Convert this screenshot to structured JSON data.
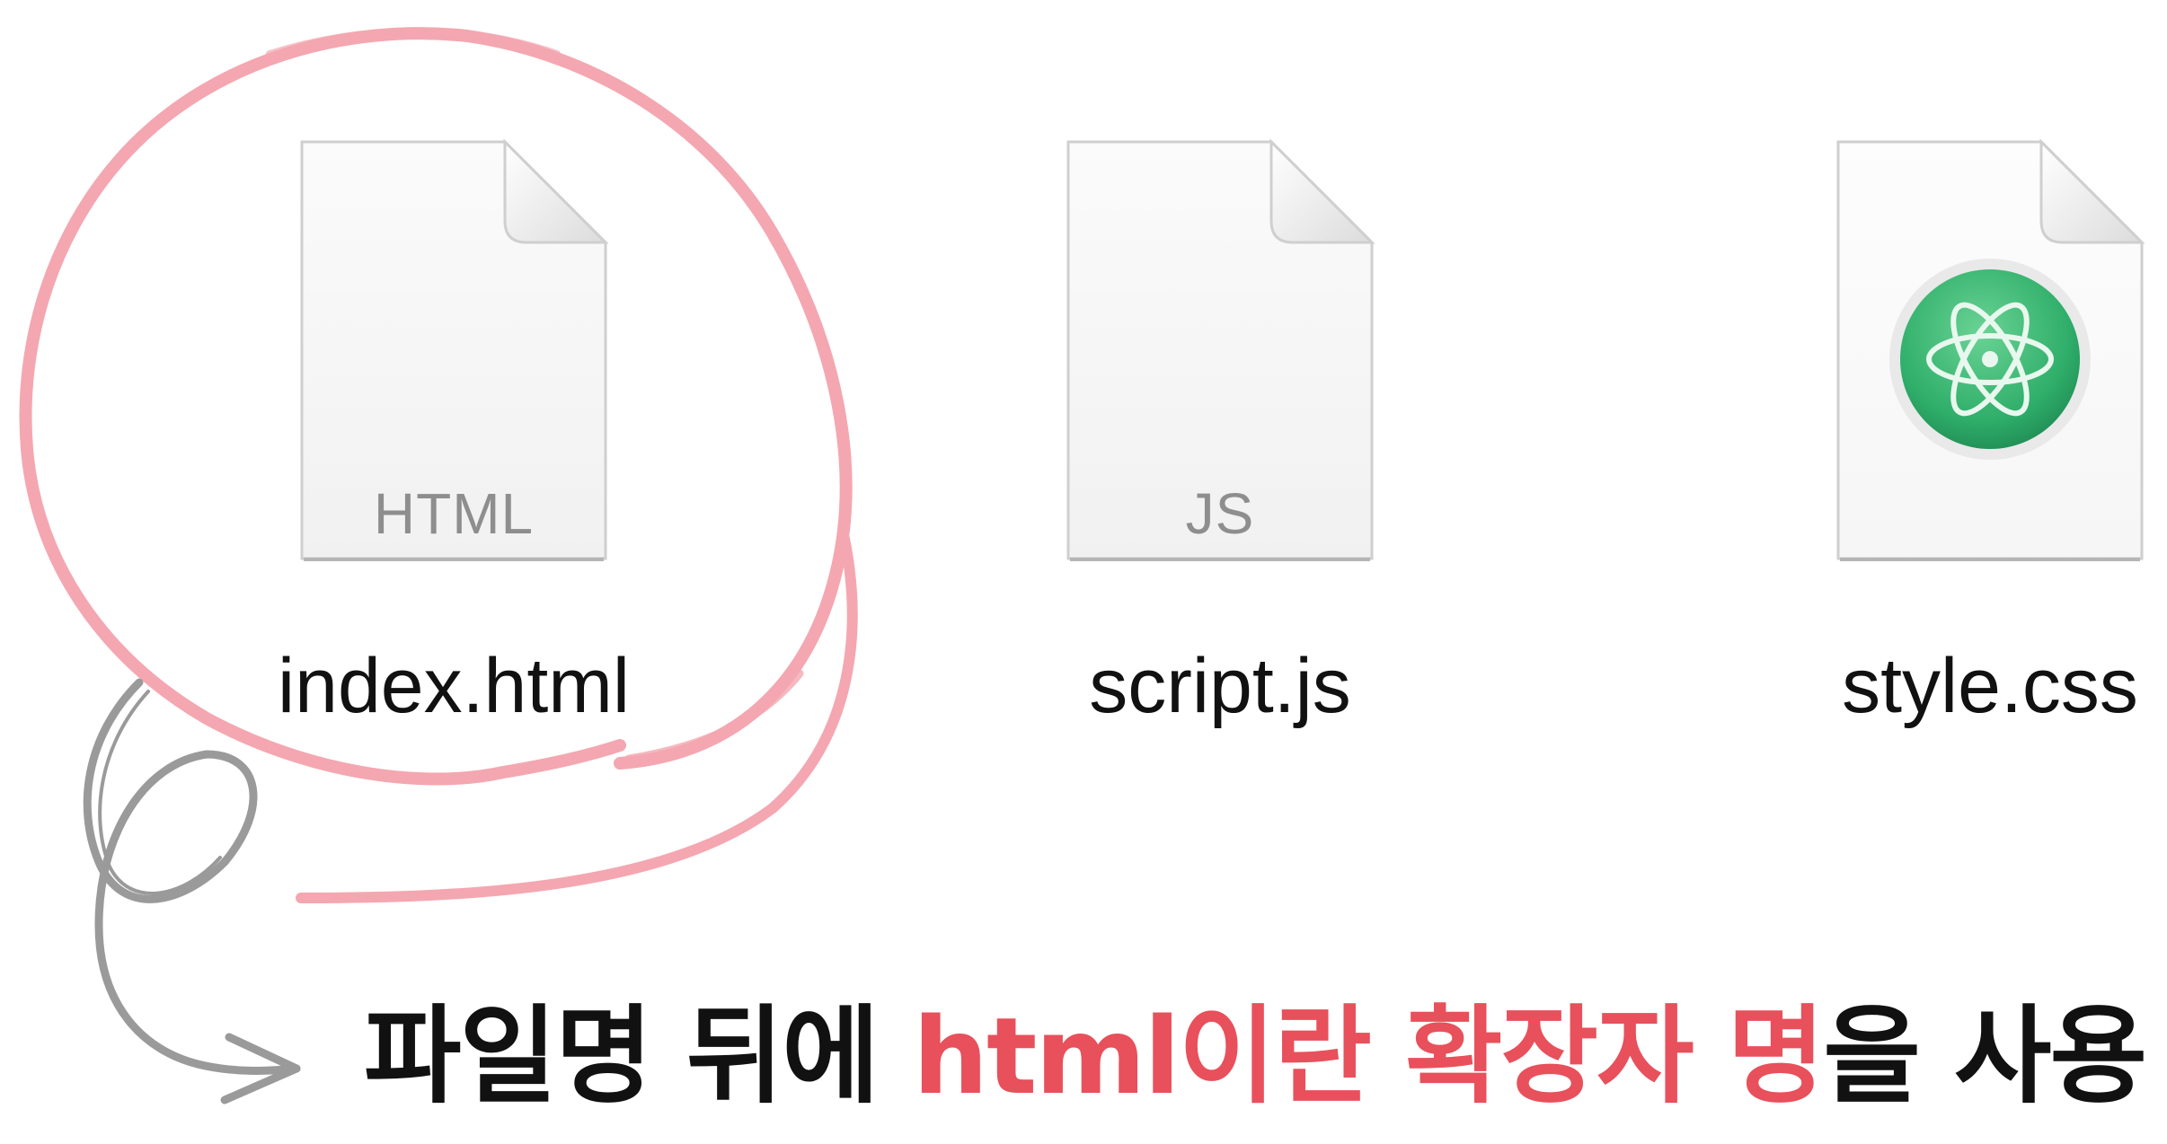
{
  "files": [
    {
      "name": "index.html",
      "type_label": "HTML",
      "icon": "generic-document-icon"
    },
    {
      "name": "script.js",
      "type_label": "JS",
      "icon": "generic-document-icon"
    },
    {
      "name": "style.css",
      "type_label": "",
      "icon": "atom-app-icon"
    }
  ],
  "annotation": {
    "circle_color": "#f4a7b0",
    "arrow_color": "#9a9a9a",
    "caption": {
      "part1": "파일명 뒤에 ",
      "highlight1": "html이란 확장자 명",
      "part2": "을 사용",
      "text_color": "#111111",
      "highlight_color": "#e8505b"
    }
  },
  "colors": {
    "background": "#ffffff",
    "document_fill": "#f6f6f6",
    "document_edge": "#c9c9c9",
    "atom_green": "#2fae6a"
  }
}
